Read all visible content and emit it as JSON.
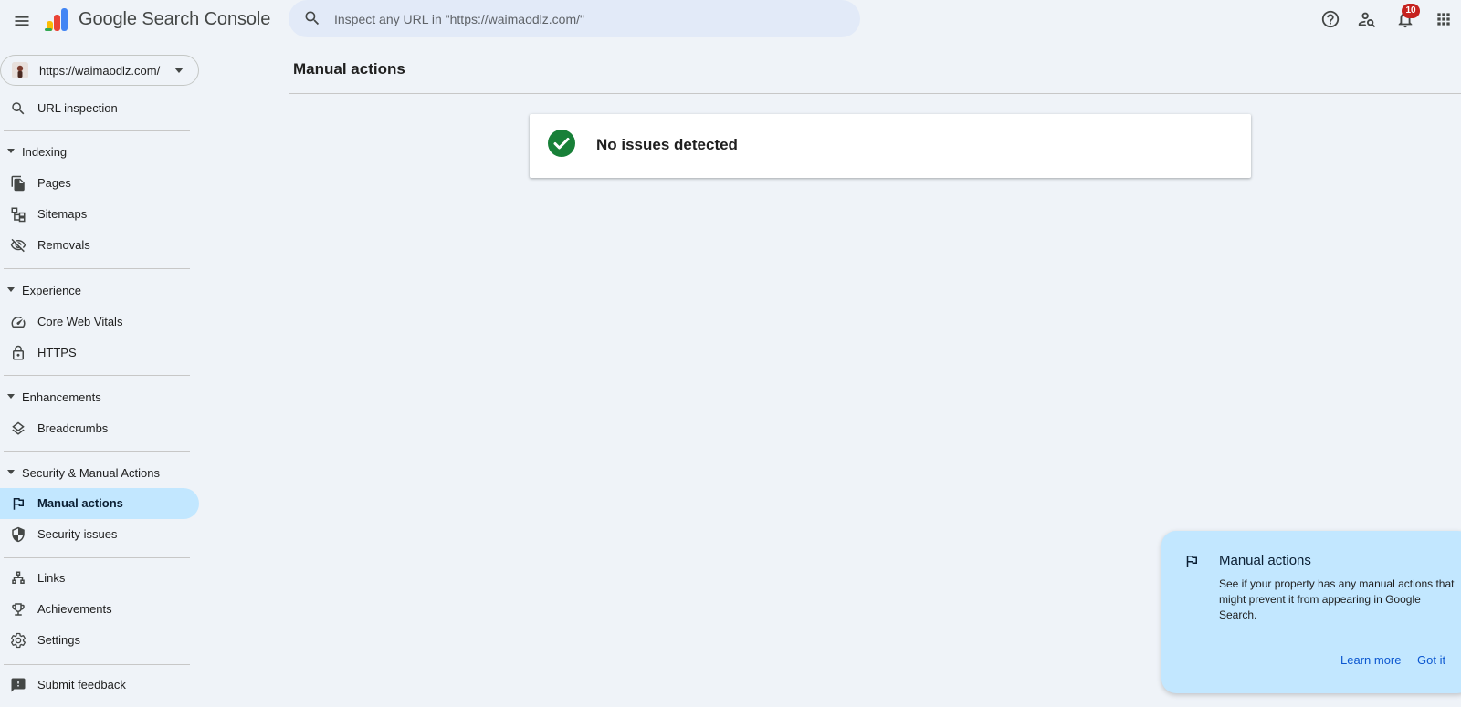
{
  "app": {
    "product_name": "Google Search Console",
    "search_placeholder": "Inspect any URL in \"https://waimaodlz.com/\"",
    "notification_count": "10"
  },
  "property": {
    "url": "https://waimaodlz.com/"
  },
  "sidebar": {
    "url_inspection": "URL inspection",
    "sections": {
      "indexing": "Indexing",
      "experience": "Experience",
      "enhancements": "Enhancements",
      "security": "Security & Manual Actions"
    },
    "items": {
      "pages": "Pages",
      "sitemaps": "Sitemaps",
      "removals": "Removals",
      "core_web_vitals": "Core Web Vitals",
      "https": "HTTPS",
      "breadcrumbs": "Breadcrumbs",
      "manual_actions": "Manual actions",
      "security_issues": "Security issues",
      "links": "Links",
      "achievements": "Achievements",
      "settings": "Settings",
      "submit_feedback": "Submit feedback"
    },
    "active_item": "manual_actions"
  },
  "main": {
    "title": "Manual actions",
    "status": "No issues detected"
  },
  "tooltip": {
    "title": "Manual actions",
    "body": "See if your property has any manual actions that might prevent it from appearing in Google Search.",
    "learn_more": "Learn more",
    "got_it": "Got it"
  },
  "colors": {
    "background": "#eff3f8",
    "active_nav": "#c2e7ff",
    "success": "#188038",
    "badge": "#c5221f",
    "link": "#0b57d0"
  }
}
